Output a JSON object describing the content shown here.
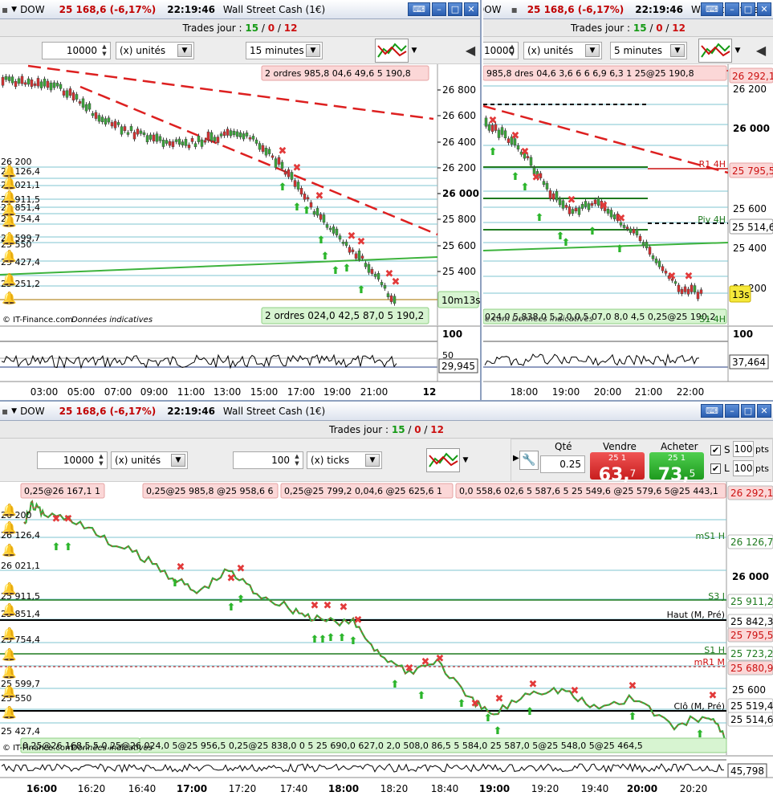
{
  "window_title": {
    "symbol": "DOW",
    "price_change": "25 168,6 (-6,17%)",
    "time": "22:19:46",
    "instrument": "Wall Street Cash (1€)"
  },
  "trades_bar": {
    "label": "Trades jour : ",
    "a": "15",
    "sep1": " / ",
    "b": "0",
    "sep2": " / ",
    "c": "12"
  },
  "top_left": {
    "qty": "10000",
    "unit": "(x) unités",
    "interval": "15 minutes",
    "orders_banner": "2 ordres  985,8  04,6  49,6  5 190,8",
    "orders_banner_bottom": "2 ordres  024,0  42,5  87,0  5 190,2",
    "countdown": "10m13s",
    "source": "© IT-Finance.com",
    "source_note": "Données indicatives",
    "price_ticks": [
      "26 800",
      "26 600",
      "26 400",
      "26 200",
      "26 000",
      "25 800",
      "25 600",
      "25 400"
    ],
    "left_levels": [
      "26 200",
      "26 126,4",
      "26 021,1",
      "25 911,5",
      "25 851,4",
      "25 754,4",
      "25 599,7",
      "25 550",
      "25 427,4",
      "25 251,2"
    ],
    "osc_ticks": [
      "100",
      "50"
    ],
    "osc_value": "29,945",
    "time_ticks": [
      "03:00",
      "05:00",
      "07:00",
      "09:00",
      "11:00",
      "13:00",
      "15:00",
      "17:00",
      "19:00",
      "21:00",
      "12"
    ]
  },
  "top_right": {
    "qty": "10000",
    "unit": "(x) unités",
    "interval": "5 minutes",
    "orders_banner": "985,8 dres  04,6 3,6 6  6 6,9 6,3 1  25@25 190,8",
    "orders_banner_bottom": "024,0  5,838,0 5,2 0,0 5  07,0 8,0 4,5  0,25@25 190,2",
    "countdown": "13s",
    "source": "e.com",
    "source_note": "Données indicatives",
    "price_ticks": [
      "26 200",
      "26 000",
      "25 600",
      "25 400",
      "25 200"
    ],
    "level_labels": [
      "26 292,1",
      "25 795,5",
      "25 514,6"
    ],
    "pivot_labels": [
      "R1 4H",
      "Piv 4H",
      "S1 4H"
    ],
    "osc_ticks": [
      "100"
    ],
    "osc_value": "37,464",
    "time_ticks": [
      "18:00",
      "19:00",
      "20:00",
      "21:00",
      "22:00"
    ]
  },
  "bottom": {
    "qty": "10000",
    "unit": "(x) unités",
    "ticks": "100",
    "ticks_unit": "(x) ticks",
    "order_panel": {
      "qty_label": "Qté",
      "qty": "0.25",
      "sell_label": "Vendre",
      "sell_small": "25 1",
      "sell_big": "63,",
      "sell_sup": "7",
      "buy_label": "Acheter",
      "buy_small": "25 1",
      "buy_big": "73,",
      "buy_sup": "5",
      "stop_label": "S",
      "stop_pts": "100",
      "limit_label": "L",
      "limit_pts": "100",
      "pts": "pts"
    },
    "orders_banner_top": [
      "0,25@26 167,1 1",
      "0,25@25 985,8  @25 958,6  6",
      "0,25@25 799,2  0,04,6 @25 625,6 1",
      "0,0  558,6  02,6 5  587,6 5  25 549,6  @25 579,6  5@25 443,1"
    ],
    "orders_banner_bottom": "0,25@26 168,5  5  0,25@26 024,0 5@25 956,5  0,25@25 838,0 0 5 25 690,0  627,0  2,0 508,0 86,5 5 584,0 25 587,0 5@25 548,0  5@25 464,5",
    "source": "© IT-Finance.com",
    "source_note": "Données indicatives",
    "price_ticks": [
      "26 000",
      "25 600"
    ],
    "level_labels": [
      "26 292,1",
      "26 126,7",
      "25 911,2",
      "25 842,3",
      "25 795,5",
      "25 723,2",
      "25 680,9",
      "25 519,4",
      "25 514,6"
    ],
    "pivot_labels": [
      "mS1 H",
      "S3 J",
      "Haut (M, Pré)",
      "S1 H",
      "mR1 M",
      "Clô (M, Pré)"
    ],
    "left_levels": [
      "26 200",
      "26 126,4",
      "26 021,1",
      "25 911,5",
      "25 851,4",
      "25 754,4",
      "25 599,7",
      "25 550",
      "25 427,4"
    ],
    "osc_value": "45,798",
    "time_ticks": [
      "16:00",
      "16:20",
      "16:40",
      "17:00",
      "17:20",
      "17:40",
      "18:00",
      "18:20",
      "18:40",
      "19:00",
      "19:20",
      "19:40",
      "20:00",
      "20:20"
    ]
  },
  "colors": {
    "red": "#cc1010",
    "green": "#159a15",
    "accent": "#2a5eb0"
  }
}
